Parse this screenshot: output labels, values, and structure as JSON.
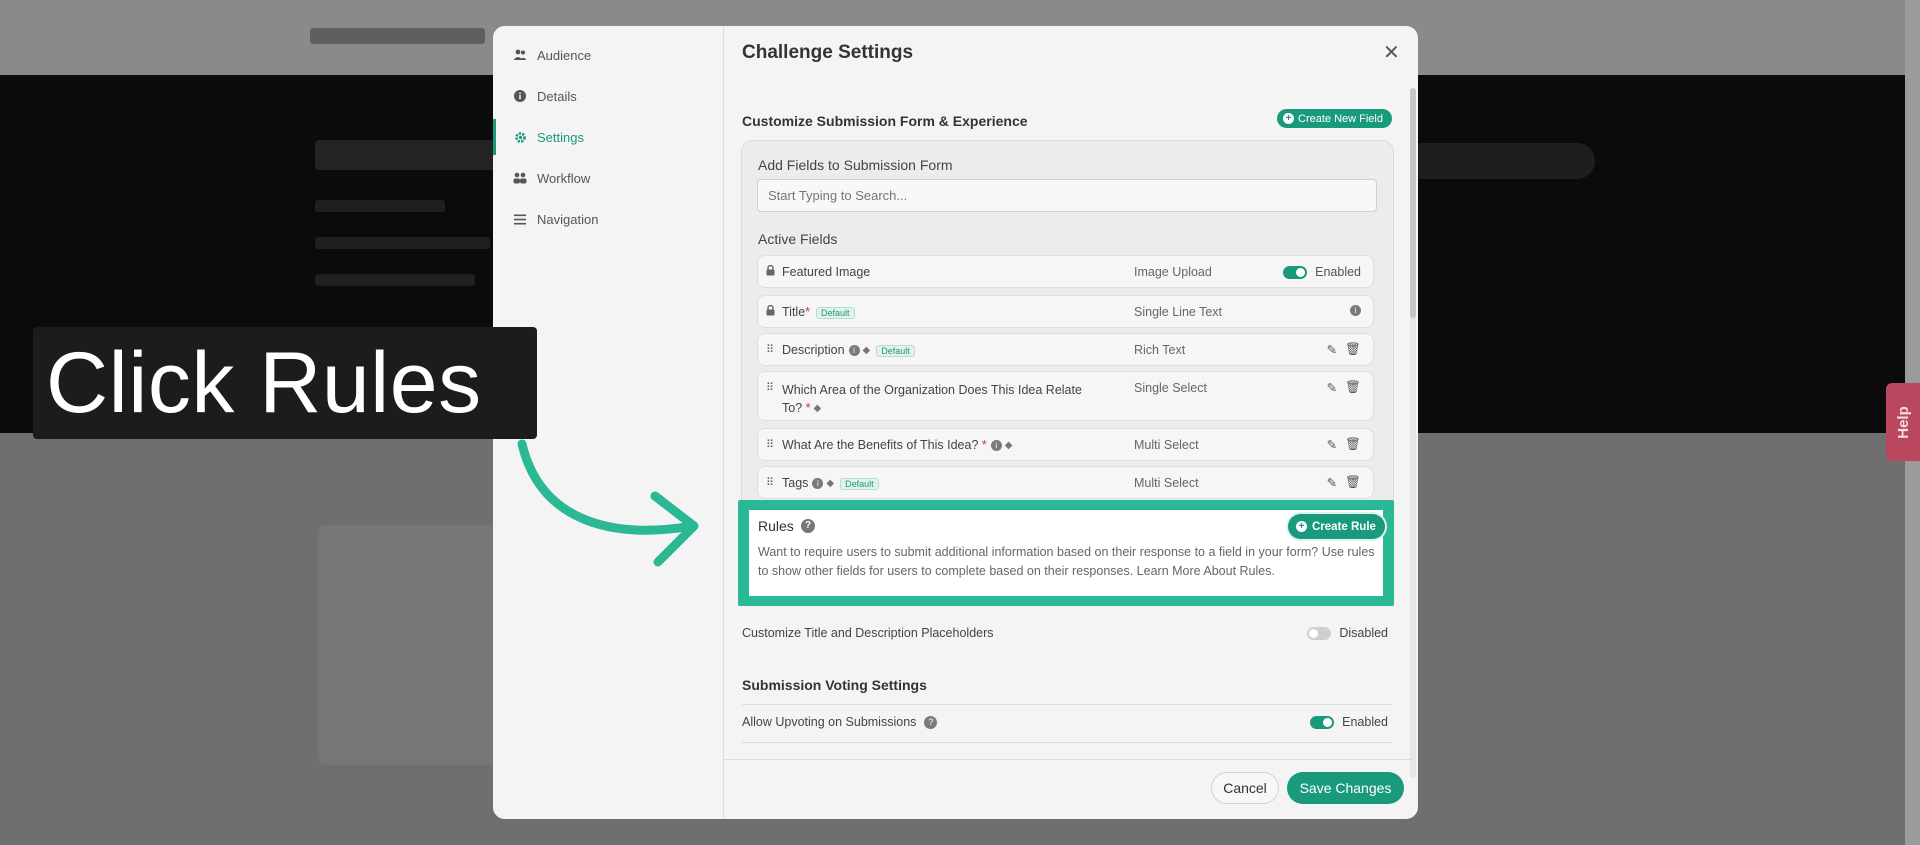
{
  "callout": {
    "text": "Click Rules"
  },
  "help_tab": {
    "label": "Help"
  },
  "modal": {
    "title": "Challenge Settings",
    "close_glyph": "✕",
    "nav": [
      {
        "label": "Audience",
        "icon": "users-icon"
      },
      {
        "label": "Details",
        "icon": "info-icon"
      },
      {
        "label": "Settings",
        "icon": "gear-icon",
        "active": true
      },
      {
        "label": "Workflow",
        "icon": "people-icon"
      },
      {
        "label": "Navigation",
        "icon": "menu-icon"
      }
    ],
    "submission_form": {
      "heading": "Customize Submission Form & Experience",
      "create_field_label": "Create New Field",
      "add_fields_label": "Add Fields to Submission Form",
      "search_placeholder": "Start Typing to Search...",
      "active_fields_label": "Active Fields",
      "fields": [
        {
          "name": "Featured Image",
          "type": "Image Upload",
          "status": "Enabled"
        },
        {
          "name": "Title",
          "type": "Single Line Text",
          "badge": "Default"
        },
        {
          "name": "Description",
          "type": "Rich Text",
          "badge": "Default"
        },
        {
          "name": "Which Area of the Organization Does This Idea Relate",
          "name_line2": "To?",
          "type": "Single Select"
        },
        {
          "name": "What Are the Benefits of This Idea?",
          "type": "Multi Select"
        },
        {
          "name": "Tags",
          "type": "Multi Select",
          "badge": "Default"
        }
      ]
    },
    "rules": {
      "title": "Rules",
      "create_label": "Create Rule",
      "description": "Want to require users to submit additional information based on their response to a field in your form? Use rules to show other fields for users to complete based on their responses. Learn More About Rules."
    },
    "placeholders_setting": {
      "label": "Customize Title and Description Placeholders",
      "status": "Disabled"
    },
    "voting": {
      "heading": "Submission Voting Settings",
      "upvoting_label": "Allow Upvoting on Submissions",
      "upvoting_status": "Enabled"
    },
    "cancel_label": "Cancel",
    "save_label": "Save Changes"
  },
  "colors": {
    "accent": "#1a9a7c",
    "highlight": "#2bb894",
    "help_tab": "#b9485f"
  }
}
